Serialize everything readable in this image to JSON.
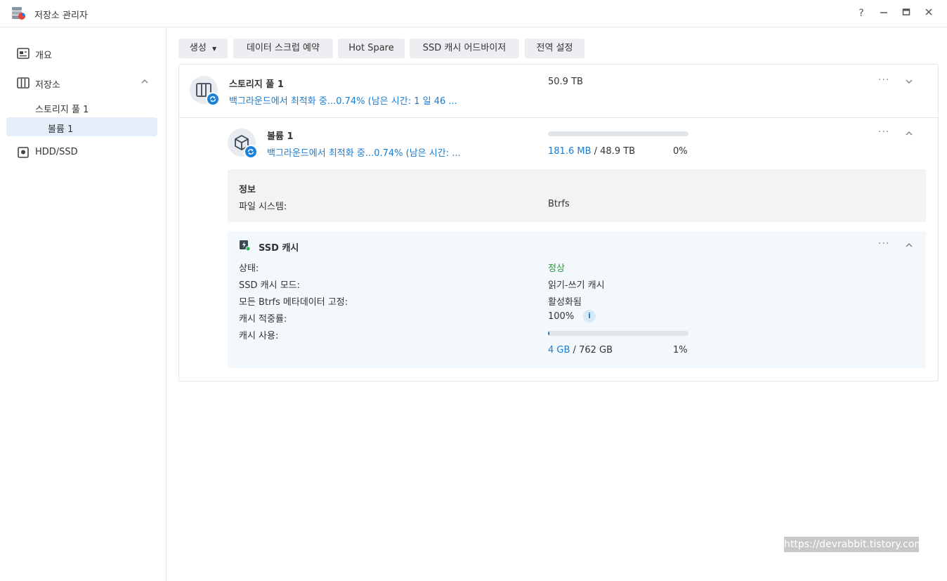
{
  "window": {
    "title": "저장소 관리자",
    "help": "?",
    "minimize": "—",
    "maximize": "□",
    "close": "✕"
  },
  "sidebar": {
    "overview": "개요",
    "storage": "저장소",
    "pool": "스토리지 풀 1",
    "volume": "볼륨 1",
    "hdd": "HDD/SSD"
  },
  "toolbar": {
    "create": "생성",
    "scrub": "데이터 스크럽 예약",
    "hotspare": "Hot Spare",
    "advisor": "SSD 캐시 어드바이저",
    "global": "전역 설정"
  },
  "pool": {
    "name": "스토리지 풀 1",
    "status": "백그라운드에서 최적화 중...0.74% (남은 시간: 1 일 46 ...",
    "size": "50.9 TB",
    "more": "···"
  },
  "volume": {
    "name": "볼륨 1",
    "status": "백그라운드에서 최적화 중...0.74% (남은 시간: ...",
    "used": "181.6 MB",
    "sep": "/",
    "total": "48.9 TB",
    "percent": "0%",
    "usage_fraction": 0.0,
    "more": "···"
  },
  "info": {
    "heading": "정보",
    "fs_label": "파일 시스템:",
    "fs_value": "Btrfs"
  },
  "ssd_cache": {
    "title": "SSD 캐시",
    "more": "···",
    "status_label": "상태:",
    "status_value": "정상",
    "mode_label": "SSD 캐시 모드:",
    "mode_value": "읽기-쓰기 캐시",
    "pin_label": "모든 Btrfs 메타데이터 고정:",
    "pin_value": "활성화됨",
    "hit_label": "캐시 적중률:",
    "hit_value": "100%",
    "info_icon": "i",
    "usage_label": "캐시 사용:",
    "usage_used": "4 GB",
    "usage_sep": "/",
    "usage_total": "762 GB",
    "usage_percent": "1%",
    "usage_fraction": 0.01,
    "status_color": "#2b9a3a"
  },
  "watermark": "https://devrabbit.tistory.com",
  "colors": {
    "accent": "#1a7cd0",
    "selected": "#e3eefa"
  }
}
